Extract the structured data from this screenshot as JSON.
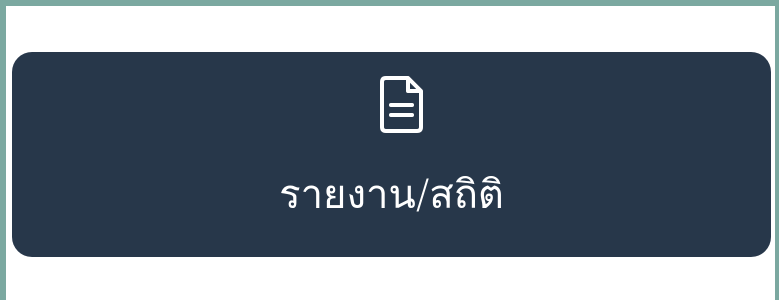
{
  "card": {
    "label": "รายงาน/สถิติ",
    "icon": "document-icon",
    "background_color": "#27374a",
    "text_color": "#ffffff"
  },
  "frame": {
    "border_color": "#7ba8a0",
    "background_color": "#ffffff"
  }
}
